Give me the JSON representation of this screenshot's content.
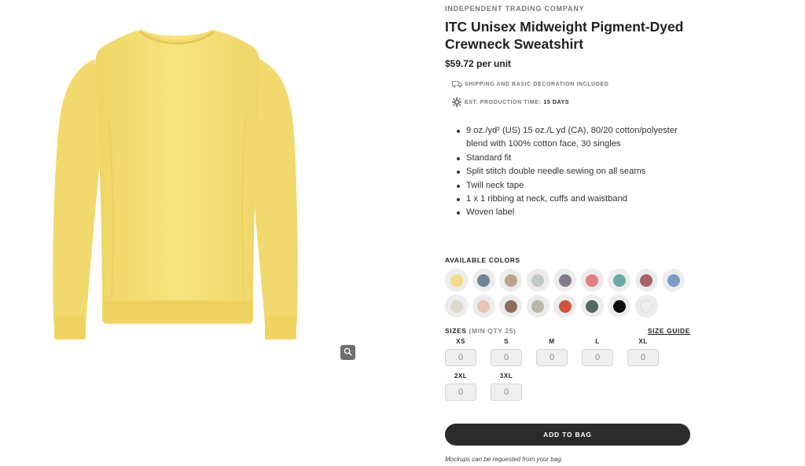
{
  "product": {
    "brand": "INDEPENDENT TRADING COMPANY",
    "title": "ITC Unisex Midweight Pigment-Dyed Crewneck Sweatshirt",
    "price": "$59.72 per unit",
    "shipping": "SHIPPING AND BASIC DECORATION INCLUDED",
    "production_label": "EST. PRODUCTION TIME:",
    "production_value": "15 DAYS",
    "garment_color": "#f7e27a"
  },
  "features": [
    "9 oz./yd² (US) 15 oz./L yd (CA), 80/20 cotton/polyester blend with 100% cotton face, 30 singles",
    "Standard fit",
    "Split stitch double needle sewing on all seams",
    "Twill neck tape",
    "1 x 1 ribbing at neck, cuffs and waistband",
    "Woven label"
  ],
  "colors": {
    "label": "AVAILABLE COLORS",
    "swatches": [
      "#f3dc85",
      "#6e8597",
      "#b9a58c",
      "#bfcbc1",
      "#857a88",
      "#e07f84",
      "#6fa9a5",
      "#a8636c",
      "#7a9bc9",
      "#ded8c8",
      "#ebc2b3",
      "#8e6c58",
      "#bab5a4",
      "#d4523a",
      "#4f6b5e",
      "#0d0d0d",
      "#eeeeee"
    ]
  },
  "sizes": {
    "label": "SIZES",
    "min_note": "(MIN QTY 25)",
    "guide": "SIZE GUIDE",
    "options": [
      {
        "name": "XS",
        "qty": "0"
      },
      {
        "name": "S",
        "qty": "0"
      },
      {
        "name": "M",
        "qty": "0"
      },
      {
        "name": "L",
        "qty": "0"
      },
      {
        "name": "XL",
        "qty": "0"
      },
      {
        "name": "2XL",
        "qty": "0"
      },
      {
        "name": "3XL",
        "qty": "0"
      }
    ]
  },
  "actions": {
    "add_to_bag": "ADD TO BAG",
    "mockup_note": "Mockups can be requested from your bag."
  },
  "icons": {
    "zoom": "magnifier-icon",
    "shipping": "truck-icon",
    "production": "gear-icon"
  }
}
